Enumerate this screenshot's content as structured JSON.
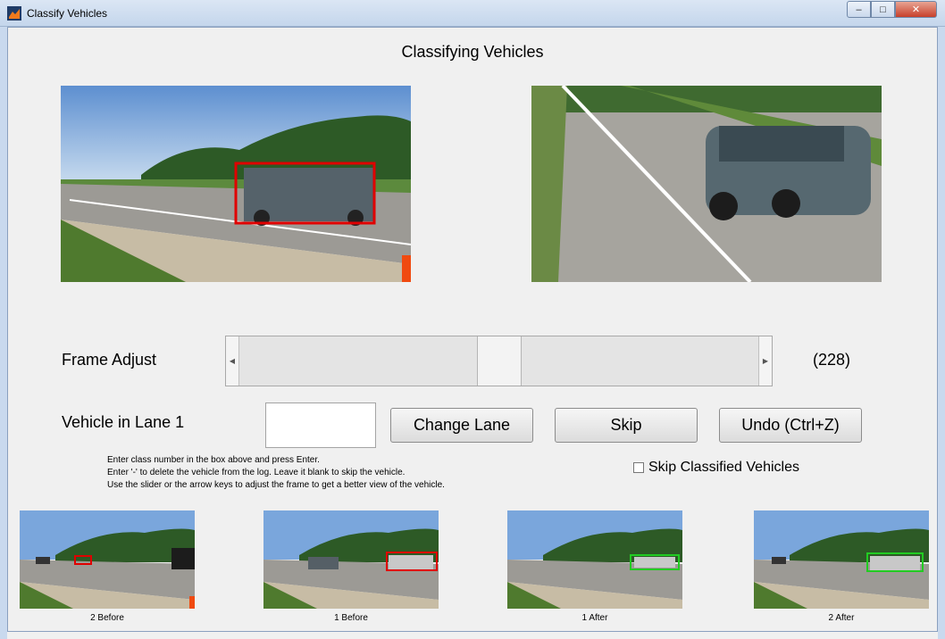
{
  "window": {
    "title": "Classify Vehicles",
    "minimize_glyph": "–",
    "maximize_glyph": "□",
    "close_glyph": "✕"
  },
  "heading": "Classifying Vehicles",
  "frame_adjust": {
    "label": "Frame Adjust",
    "value_text": "(228)",
    "slider_position_fraction": 0.5
  },
  "lane": {
    "label": "Vehicle in Lane 1",
    "input_value": ""
  },
  "buttons": {
    "change_lane": "Change Lane",
    "skip": "Skip",
    "undo": "Undo (Ctrl+Z)"
  },
  "instructions": [
    "Enter class number in the box above and press Enter.",
    "Enter '-' to delete the vehicle from the log. Leave it blank to skip the vehicle.",
    "Use the slider or the arrow keys to adjust the frame to get a better view of the vehicle."
  ],
  "skip_classified": {
    "label": "Skip Classified Vehicles",
    "checked": false
  },
  "thumbnails": [
    {
      "caption": "2 Before",
      "box_color": "#e00000"
    },
    {
      "caption": "1 Before",
      "box_color": "#e00000"
    },
    {
      "caption": "1 After",
      "box_color": "#22cc22"
    },
    {
      "caption": "2 After",
      "box_color": "#22cc22"
    }
  ],
  "colors": {
    "selection_box": "#e00000",
    "done_box": "#22cc22",
    "window_background": "#f0f0f0"
  }
}
